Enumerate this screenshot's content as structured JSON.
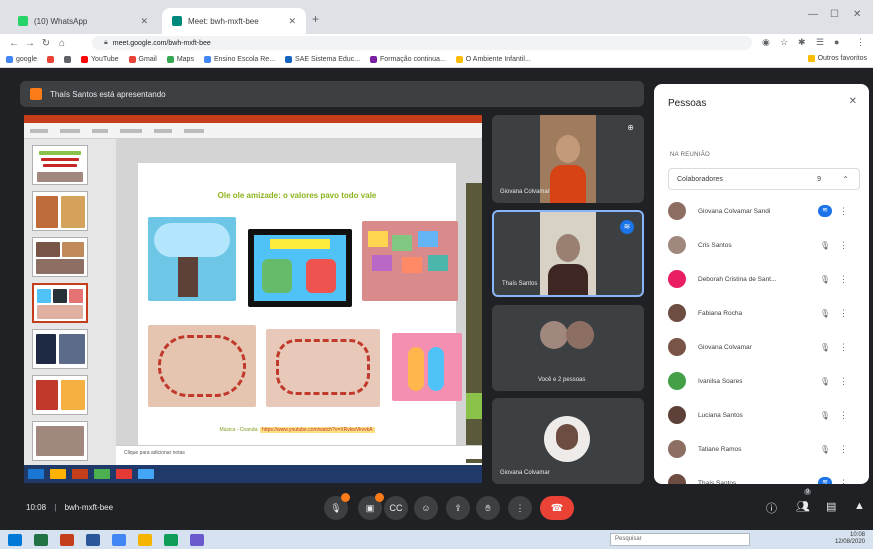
{
  "browser": {
    "tabs": [
      {
        "title": "(10) WhatsApp",
        "active": false,
        "favicon_color": "#25d366"
      },
      {
        "title": "Meet: bwh-mxft-bee",
        "active": true,
        "favicon_color": "#00897b"
      }
    ],
    "url": "meet.google.com/bwh-mxft-bee",
    "bookmarks": [
      {
        "label": "google",
        "color": "#4285f4"
      },
      {
        "label": "",
        "color": "#ea4335"
      },
      {
        "label": "",
        "color": "#5f6368"
      },
      {
        "label": "YouTube",
        "color": "#ff0000"
      },
      {
        "label": "Gmail",
        "color": "#ea4335"
      },
      {
        "label": "Maps",
        "color": "#34a853"
      },
      {
        "label": "Ensino Escola Re...",
        "color": "#4285f4"
      },
      {
        "label": "SAE Sistema Educ...",
        "color": "#1565c0"
      },
      {
        "label": "Formação continua...",
        "color": "#7b1fa2"
      },
      {
        "label": "O Ambiente Infantil...",
        "color": "#fbbc04"
      }
    ],
    "other_bookmarks": "Outros favoritos"
  },
  "meet": {
    "presenter_banner": "Thaís Santos está apresentando",
    "time": "10:08",
    "meeting_code": "bwh-mxft-bee",
    "people_count": "9",
    "slide": {
      "title": "Ole ole amizade: o valores pavo todo vale",
      "footer_prefix": "Música - Ciranda:",
      "footer_link": "https://www.youtube.com/watch?v=XRvkwVkvvkA",
      "notes_placeholder": "Clique para adicionar notas"
    },
    "tiles": [
      {
        "name": "Giovana Colvamar",
        "active": false
      },
      {
        "name": "Thaís Santos",
        "active": true
      },
      {
        "name": "Você e 2 pessoas",
        "active": false
      },
      {
        "name": "Giovana Colvamar",
        "active": false
      }
    ]
  },
  "people_panel": {
    "title": "Pessoas",
    "section_label": "NA REUNIÃO",
    "collaborators_label": "Colaboradores",
    "collaborators_count": "9",
    "participants": [
      {
        "name": "Giovana Colvamar Sandi",
        "avatar_color": "#8d6e63",
        "speaking": true
      },
      {
        "name": "Cris Santos",
        "avatar_color": "#a1887f",
        "speaking": false
      },
      {
        "name": "Deborah Cristina de Sant...",
        "avatar_color": "#e91e63",
        "speaking": false
      },
      {
        "name": "Fabiana Rocha",
        "avatar_color": "#6d4c41",
        "speaking": false
      },
      {
        "name": "Giovana Colvamar",
        "avatar_color": "#795548",
        "speaking": false
      },
      {
        "name": "Ivanilsa Soares",
        "avatar_color": "#43a047",
        "speaking": false
      },
      {
        "name": "Luciana Santos",
        "avatar_color": "#5d4037",
        "speaking": false
      },
      {
        "name": "Tatiane Ramos",
        "avatar_color": "#8d6e63",
        "speaking": false
      },
      {
        "name": "Thaís Santos",
        "avatar_color": "#6d4c41",
        "speaking": true
      }
    ]
  },
  "windows": {
    "search_placeholder": "Pesquisar",
    "clock_time": "10:08",
    "clock_date": "12/08/2020"
  }
}
